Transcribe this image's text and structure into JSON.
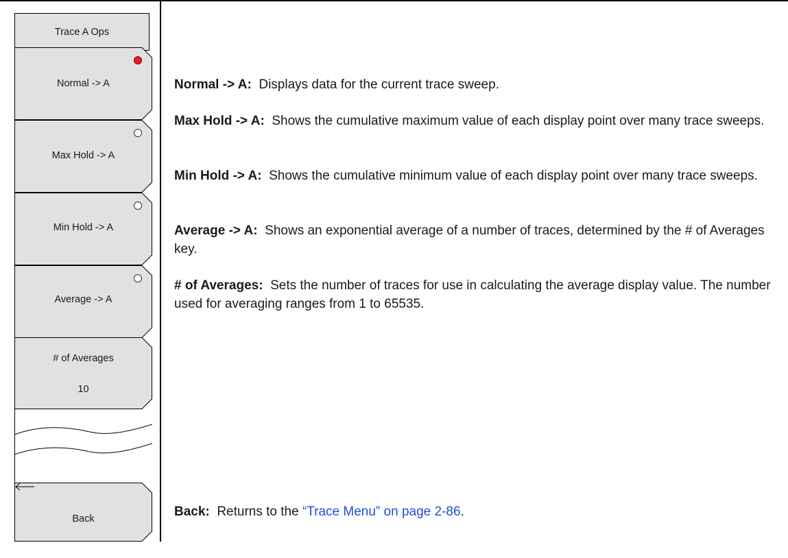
{
  "menu": {
    "title": "Trace A Ops",
    "keys": [
      {
        "label": "Normal -> A",
        "selected": true
      },
      {
        "label": "Max Hold -> A",
        "selected": false
      },
      {
        "label": "Min Hold -> A",
        "selected": false
      },
      {
        "label": "Average -> A",
        "selected": false
      }
    ],
    "averages": {
      "label": "# of Averages",
      "value": "10"
    },
    "back": {
      "label": "Back",
      "icon": "left-arrow-icon"
    }
  },
  "descriptions": [
    {
      "term": "Normal -> A:",
      "text": "Displays data for the current trace sweep."
    },
    {
      "term": "Max Hold -> A:",
      "text": "Shows the cumulative maximum value of each display point over many trace sweeps."
    },
    {
      "term": "Min Hold -> A:",
      "text": "Shows the cumulative minimum value of each display point over many trace sweeps."
    },
    {
      "term": "Average -> A:",
      "text": "Shows an exponential average of a number of traces, determined by the # of Averages key."
    },
    {
      "term": "# of Averages:",
      "text": "Sets the number of traces for use in calculating the average display value. The number used for averaging ranges from 1 to 65535."
    }
  ],
  "back_description": {
    "term": "Back:",
    "text_before": "Returns to the",
    "link": "“Trace Menu” on page 2-86",
    "text_after": "."
  },
  "colors": {
    "key_fill": "#e1e1e1",
    "radio_selected": "#ee1c1c",
    "link": "#1f4ed8"
  }
}
